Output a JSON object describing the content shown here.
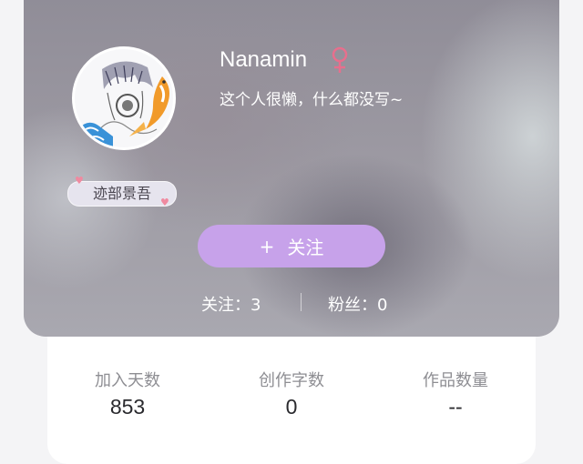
{
  "profile": {
    "username": "Nanamin",
    "gender_icon": "female-icon",
    "signature": "这个人很懒，什么都没写~",
    "badge": "迹部景吾"
  },
  "follow_button": {
    "plus": "+",
    "label": "关注"
  },
  "follow_stats": {
    "following": "关注：3",
    "followers": "粉丝：0"
  },
  "stats": [
    {
      "label": "加入天数",
      "value": "853"
    },
    {
      "label": "创作字数",
      "value": "0"
    },
    {
      "label": "作品数量",
      "value": "--"
    }
  ],
  "colors": {
    "follow_button": "#c7a2ea",
    "gender_icon": "#e76f8d",
    "stats_label": "#8e8e93",
    "stats_value": "#2a2a2e"
  }
}
